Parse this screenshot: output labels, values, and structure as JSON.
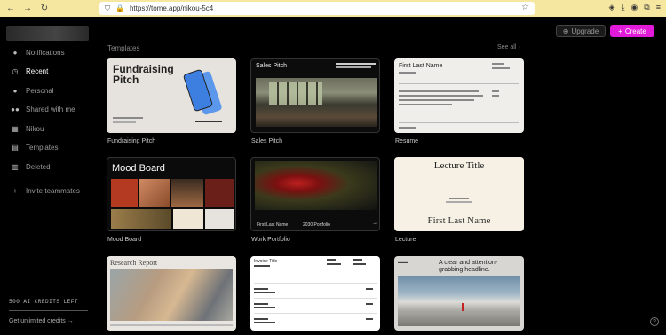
{
  "browser": {
    "url": "https://tome.app/nikou-5c4",
    "back_icon": "←",
    "forward_icon": "→",
    "reload_icon": "↻",
    "star_icon": "☆"
  },
  "sidebar": {
    "items": [
      {
        "label": "Notifications",
        "icon": "🔔"
      },
      {
        "label": "Recent",
        "icon": "🕓"
      },
      {
        "label": "Personal",
        "icon": "👤"
      },
      {
        "label": "Shared with me",
        "icon": "👥"
      },
      {
        "label": "Nikou",
        "icon": "▦"
      },
      {
        "label": "Templates",
        "icon": "▤"
      },
      {
        "label": "Deleted",
        "icon": "🗑"
      },
      {
        "label": "Invite teammates",
        "icon": "👤+"
      }
    ],
    "credits": "500 AI CREDITS LEFT",
    "get_credits": "Get unlimited credits →"
  },
  "header": {
    "upgrade": "Upgrade",
    "create": "Create"
  },
  "templates": {
    "section_title": "Templates",
    "see_all": "See all ›",
    "cards": [
      {
        "caption": "Fundraising Pitch",
        "title": "Fundraising Pitch"
      },
      {
        "caption": "Sales Pitch",
        "title": "Sales Pitch"
      },
      {
        "caption": "Resume",
        "title": "First Last Name"
      },
      {
        "caption": "Mood Board",
        "title": "Mood Board"
      },
      {
        "caption": "Work Portfolio",
        "title": "First Last Name",
        "subtitle": "2030 Portfolio",
        "arrow": "→"
      },
      {
        "caption": "Lecture",
        "title": "Lecture Title",
        "name": "First Last Name"
      },
      {
        "caption": "",
        "title": "Research Report"
      },
      {
        "caption": "",
        "title": "Invoice Title"
      },
      {
        "caption": "",
        "title": "A clear and attention-grabbing headline."
      }
    ]
  },
  "help": "?"
}
